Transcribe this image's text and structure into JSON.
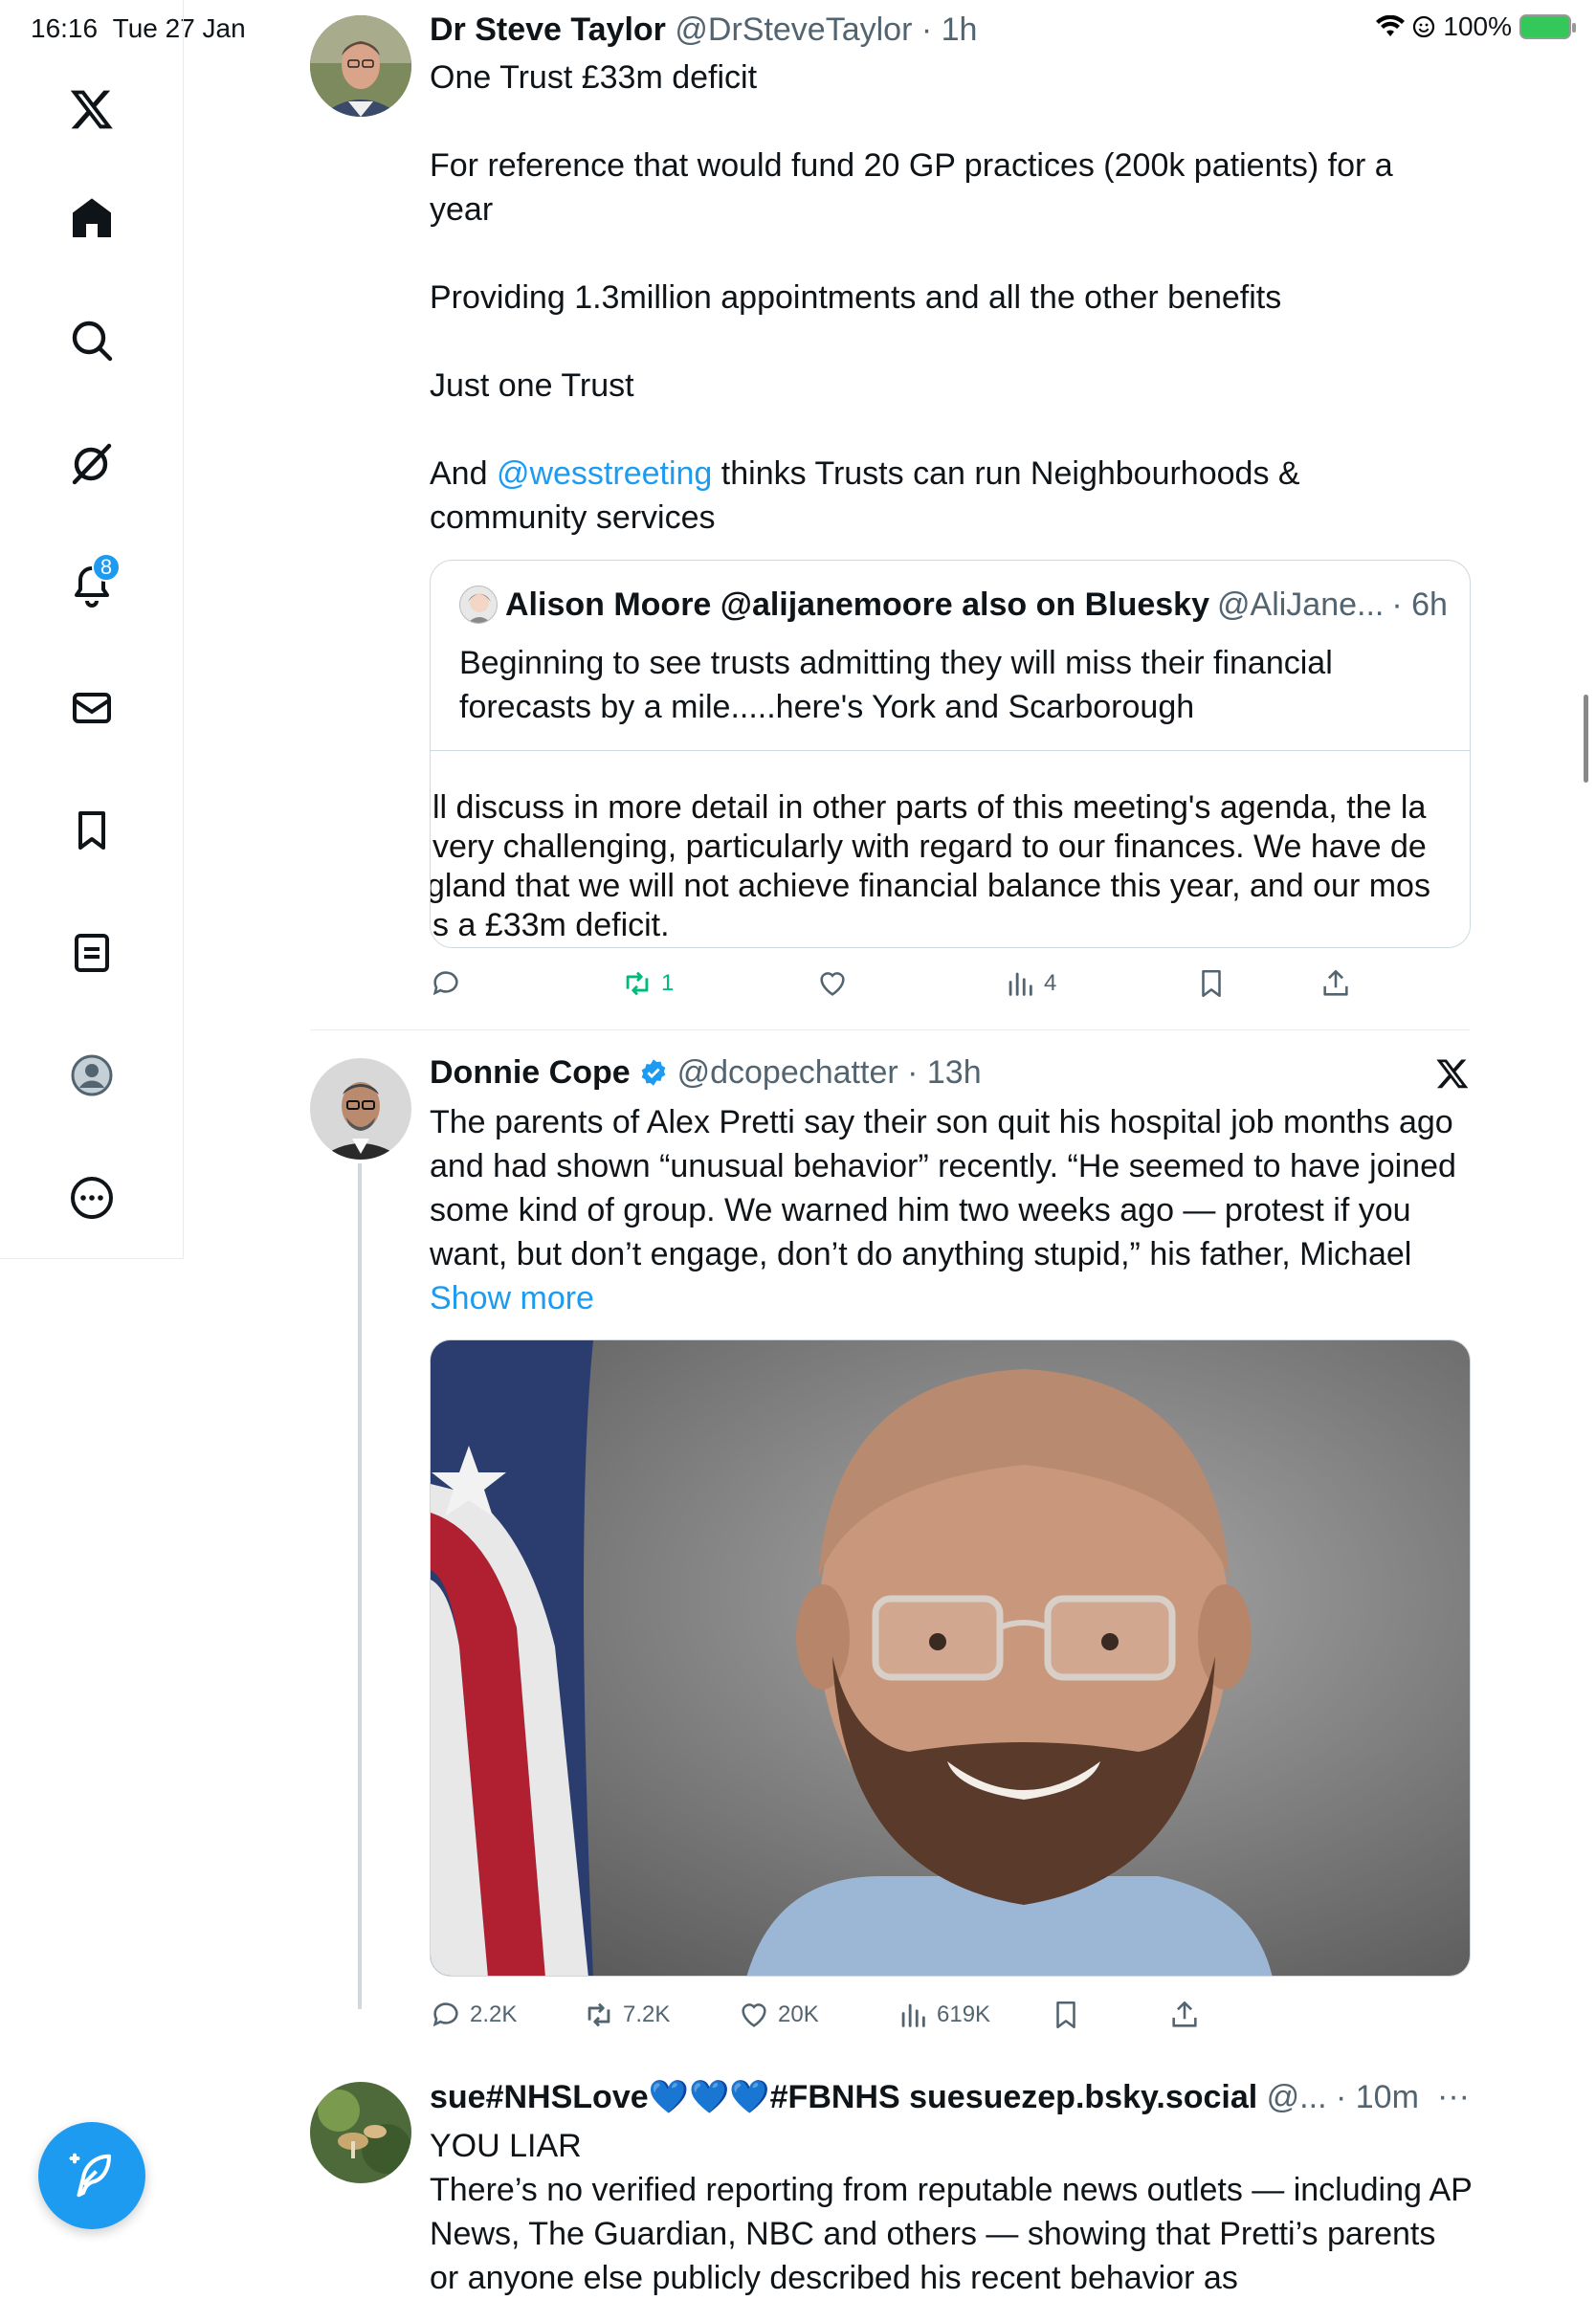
{
  "status_bar": {
    "time": "16:16",
    "date": "Tue 27 Jan",
    "battery": "100%"
  },
  "sidebar": {
    "items": [
      {
        "name": "x-logo-icon"
      },
      {
        "name": "home-icon"
      },
      {
        "name": "search-icon"
      },
      {
        "name": "grok-icon"
      },
      {
        "name": "notifications-icon",
        "badge": "8"
      },
      {
        "name": "messages-icon"
      },
      {
        "name": "bookmarks-icon"
      },
      {
        "name": "lists-icon"
      },
      {
        "name": "profile-icon"
      },
      {
        "name": "more-icon"
      }
    ]
  },
  "compose_button": {
    "icon": "compose-icon"
  },
  "posts": [
    {
      "name": "Dr Steve Taylor",
      "handle": "@DrSteveTaylor",
      "time": "· 1h",
      "text": {
        "p1": "One Trust £33m deficit",
        "p2": "For reference that would fund 20 GP practices (200k patients) for a year",
        "p3": "Providing 1.3million appointments and all the other benefits",
        "p4": "Just one Trust",
        "p5_prefix": "And ",
        "p5_mention": "@wesstreeting",
        "p5_suffix": " thinks Trusts can run Neighbourhoods & community services"
      },
      "quote": {
        "name": "Alison Moore @alijanemoore also on Bluesky",
        "handle": "@AliJane...",
        "time": "· 6h",
        "text": "Beginning to see trusts admitting they will miss their financial forecasts by a mile.....here's York and Scarborough",
        "image_lines": [
          "ll discuss in more detail in other parts of this meeting's agenda, the la",
          "very challenging, particularly with regard to our finances. We have de",
          "gland that we will not achieve financial balance this year, and our mos",
          "s a £33m deficit."
        ]
      },
      "stats": {
        "replies": "",
        "reposts": "1",
        "likes": "",
        "views": "4"
      }
    },
    {
      "name": "Donnie Cope",
      "handle": "@dcopechatter",
      "time": "· 13h",
      "verified": true,
      "text": "The parents of Alex Pretti say their son quit his hospital job months ago and had shown “unusual behavior” recently. “He seemed to have joined some kind of group. We warned him two weeks ago — protest if you want, but don’t engage, don’t do anything stupid,” his father, Michael ",
      "show_more": "Show more",
      "stats": {
        "replies": "2.2K",
        "reposts": "7.2K",
        "likes": "20K",
        "views": "619K"
      }
    },
    {
      "name": "sue#NHSLove💙💙💙#FBNHS suesuezep.bsky.social",
      "handle": "@...",
      "time": "· 10m",
      "text_line1": "YOU LIAR",
      "text_rest": "There’s no verified reporting from reputable news outlets — including AP News, The Guardian, NBC and others — showing that Pretti’s parents or anyone else publicly described his recent behavior as"
    }
  ],
  "colors": {
    "accent": "#1d9bf0",
    "repost_active": "#00ba7c",
    "text": "#0f1419",
    "secondary": "#536471",
    "border": "#cfd9de"
  }
}
